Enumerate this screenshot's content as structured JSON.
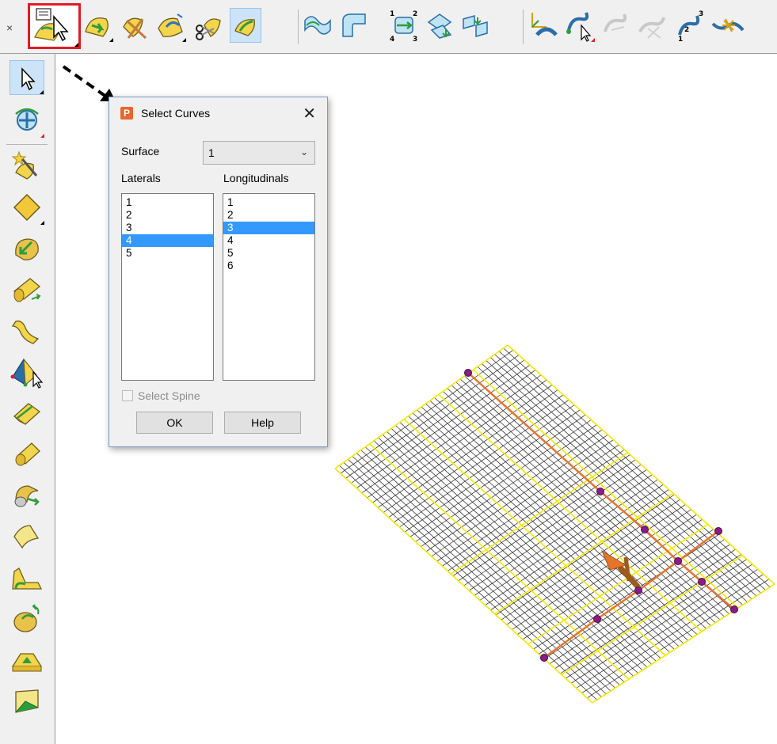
{
  "toolbar": {
    "close_glyph": "×",
    "tools": [
      {
        "icon": "select-curves-icon",
        "state": "highlighted"
      },
      {
        "icon": "surface-arrow-icon"
      },
      {
        "icon": "surface-cut-icon"
      },
      {
        "icon": "surface-twist-icon"
      },
      {
        "icon": "surface-scissors-icon"
      },
      {
        "icon": "surface-active-icon",
        "state": "active"
      },
      {
        "icon": "curves-wave-icon"
      },
      {
        "icon": "surface-corner-icon"
      },
      {
        "icon": "surface-numbered-icon"
      },
      {
        "icon": "surface-merge-icon"
      },
      {
        "icon": "surface-stack-icon"
      },
      {
        "icon": "curve-axis-icon"
      },
      {
        "icon": "curve-select-icon"
      },
      {
        "icon": "curve-disabled-icon"
      },
      {
        "icon": "curve-disabled-2-icon"
      },
      {
        "icon": "curve-numbered-icon"
      },
      {
        "icon": "curve-star-icon"
      }
    ]
  },
  "dialog": {
    "title": "Select Curves",
    "close_glyph": "✕",
    "app_icon_letter": "P",
    "surface_label": "Surface",
    "surface_value": "1",
    "laterals_label": "Laterals",
    "longitudinals_label": "Longitudinals",
    "laterals": [
      "1",
      "2",
      "3",
      "4",
      "5"
    ],
    "laterals_selected": 3,
    "longitudinals": [
      "1",
      "2",
      "3",
      "4",
      "5",
      "6"
    ],
    "longitudinals_selected": 2,
    "select_spine_label": "Select Spine",
    "select_spine_checked": false,
    "ok_label": "OK",
    "help_label": "Help"
  },
  "colors": {
    "surface_boundary": "#f5e800",
    "selected_curve": "#e8742a",
    "control_point": "#8b1a8b",
    "highlight": "#e31b23",
    "selection": "#3399ff"
  }
}
